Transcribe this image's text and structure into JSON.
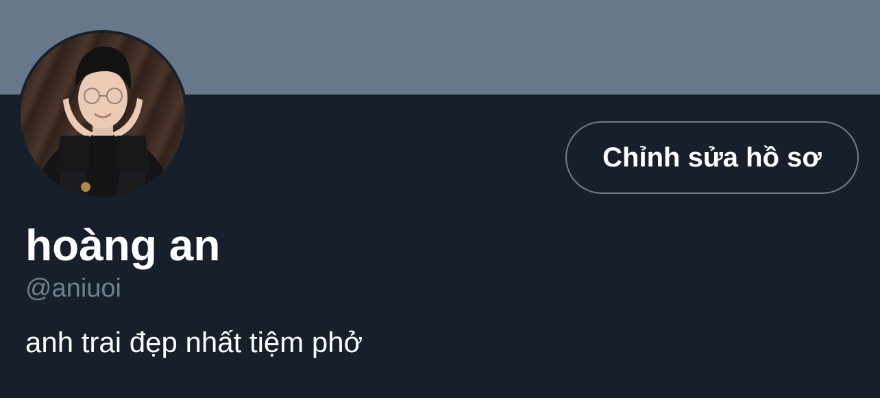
{
  "profile": {
    "display_name": "hoàng an",
    "handle": "@aniuoi",
    "bio": "anh trai đẹp nhất tiệm phở",
    "edit_button_label": "Chỉnh sửa hồ sơ"
  },
  "colors": {
    "banner": "#66788a",
    "background": "#17202a",
    "button_border": "#6e7e8f",
    "handle_text": "#6e7f90",
    "primary_text": "#ffffff"
  }
}
